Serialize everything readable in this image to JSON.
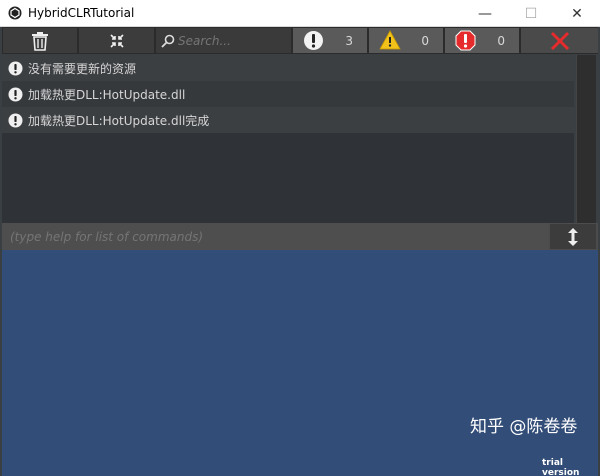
{
  "window": {
    "title": "HybridCLRTutorial",
    "minimize": "—",
    "maximize": "☐",
    "close": "✕"
  },
  "toolbar": {
    "search_placeholder": "Search...",
    "info_count": "3",
    "warning_count": "0",
    "error_count": "0"
  },
  "log": {
    "entries": [
      {
        "text": "没有需要更新的资源",
        "level": "info"
      },
      {
        "text": "加载热更DLL:HotUpdate.dll",
        "level": "info"
      },
      {
        "text": "加载热更DLL:HotUpdate.dll完成",
        "level": "info"
      }
    ]
  },
  "command": {
    "placeholder": "(type help for list of commands)"
  },
  "overlay": {
    "watermark": "知乎 @陈卷卷",
    "trial_text": "trial version"
  },
  "colors": {
    "game_background": "#324d78",
    "error_red": "#e52b2b",
    "warning_yellow": "#f2c21b"
  }
}
